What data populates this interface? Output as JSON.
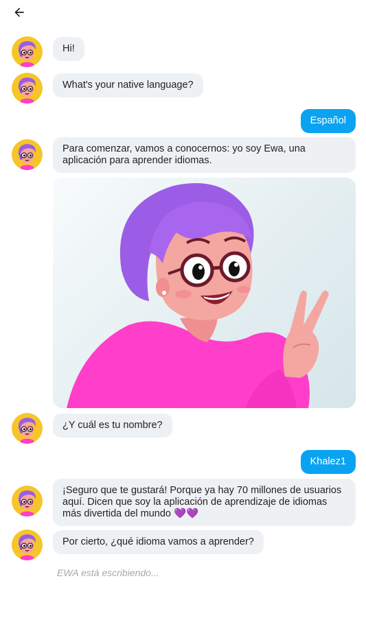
{
  "header": {
    "back_icon": "arrow-left-icon"
  },
  "bot": {
    "avatar_icon": "ewa-avatar-icon"
  },
  "messages": [
    {
      "from": "bot",
      "text": "Hi!"
    },
    {
      "from": "bot",
      "text": "What's your native language?"
    },
    {
      "from": "user",
      "text": "Español"
    },
    {
      "from": "bot",
      "text": "Para comenzar, vamos a conocernos: yo soy Ewa, una aplicación para aprender idiomas."
    },
    {
      "from": "bot",
      "type": "image",
      "image_icon": "ewa-character-illustration"
    },
    {
      "from": "bot",
      "text": "¿Y cuál es tu nombre?"
    },
    {
      "from": "user",
      "text": "Khalez1"
    },
    {
      "from": "bot",
      "text": "¡Seguro que te gustará! Porque ya hay 70 millones de usuarios aquí. Dicen que soy la aplicación de aprendizaje de idiomas más divertida del mundo",
      "emoji": "💜💜"
    },
    {
      "from": "bot",
      "text": "Por cierto, ¿qué idioma vamos a aprender?"
    }
  ],
  "typing_indicator": "EWA está escribiendo...",
  "colors": {
    "user_bubble": "#0aa3f2",
    "bot_bubble": "#eef1f4",
    "avatar_bg": "#f6c529",
    "hair": "#9b5de5",
    "sweater": "#ff3ec9"
  }
}
